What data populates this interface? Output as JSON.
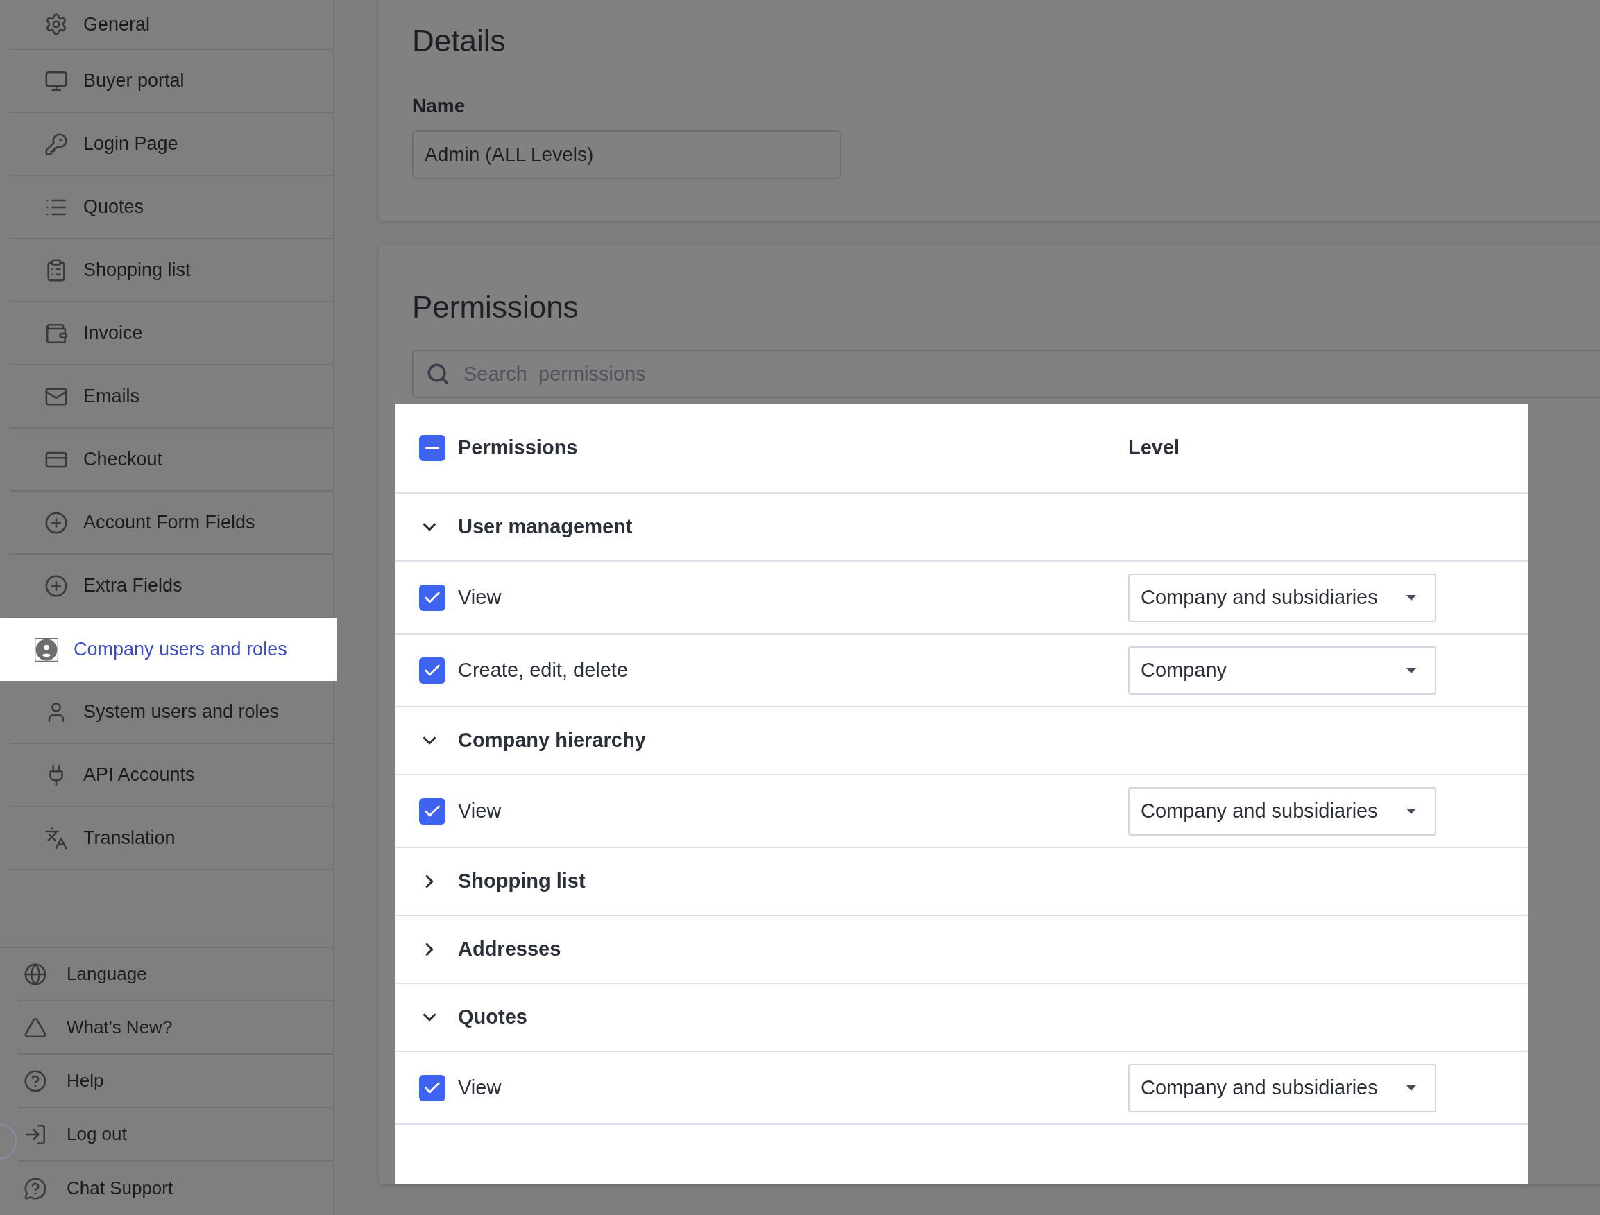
{
  "sidebar": {
    "items": [
      {
        "label": "General",
        "selected": false
      },
      {
        "label": "Buyer portal",
        "selected": false
      },
      {
        "label": "Login Page",
        "selected": false
      },
      {
        "label": "Quotes",
        "selected": false
      },
      {
        "label": "Shopping list",
        "selected": false
      },
      {
        "label": "Invoice",
        "selected": false
      },
      {
        "label": "Emails",
        "selected": false
      },
      {
        "label": "Checkout",
        "selected": false
      },
      {
        "label": "Account Form Fields",
        "selected": false
      },
      {
        "label": "Extra Fields",
        "selected": false
      },
      {
        "label": "Company users and roles",
        "selected": true
      },
      {
        "label": "System users and roles",
        "selected": false
      },
      {
        "label": "API Accounts",
        "selected": false
      },
      {
        "label": "Translation",
        "selected": false
      }
    ],
    "footer_items": [
      {
        "label": "Language"
      },
      {
        "label": "What's New?"
      },
      {
        "label": "Help"
      },
      {
        "label": "Log out"
      },
      {
        "label": "Chat Support"
      }
    ]
  },
  "details": {
    "title": "Details",
    "name_label": "Name",
    "name_value": "Admin (ALL Levels)"
  },
  "permissions": {
    "title": "Permissions",
    "search_placeholder": "Search  permissions",
    "header": {
      "indeterminate": true,
      "label": "Permissions",
      "level_label": "Level"
    },
    "groups": [
      {
        "label": "User management",
        "expanded": true,
        "children": [
          {
            "label": "View",
            "checked": true,
            "level": "Company and subsidiaries"
          },
          {
            "label": "Create, edit, delete",
            "checked": true,
            "level": "Company"
          }
        ]
      },
      {
        "label": "Company hierarchy",
        "expanded": true,
        "children": [
          {
            "label": "View",
            "checked": true,
            "level": "Company and subsidiaries"
          }
        ]
      },
      {
        "label": "Shopping list",
        "expanded": false
      },
      {
        "label": "Addresses",
        "expanded": false
      },
      {
        "label": "Quotes",
        "expanded": true,
        "children": [
          {
            "label": "View",
            "checked": true,
            "level": "Company and subsidiaries"
          }
        ]
      }
    ]
  }
}
